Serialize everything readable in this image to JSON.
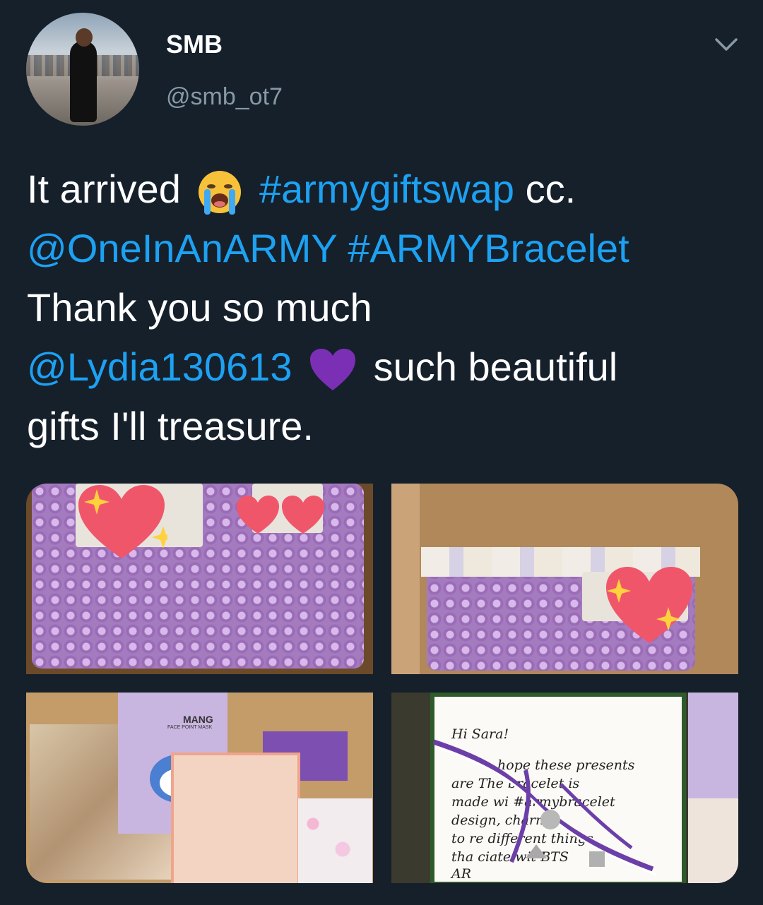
{
  "author": {
    "display_name": "SMB",
    "handle": "@smb_ot7"
  },
  "tweet": {
    "line1": {
      "text_a": "It arrived",
      "hashtag": "#armygiftswap",
      "text_b": "cc."
    },
    "line2": {
      "mention": "@OneInAnARMY",
      "hashtag": "#ARMYBracelet"
    },
    "line3": {
      "text": "Thank you so much"
    },
    "line4": {
      "mention": "@Lydia130613",
      "text": "such beautiful"
    },
    "line5": {
      "text": "gifts I'll treasure."
    }
  },
  "icons": {
    "more": "chevron-down-icon",
    "emoji1": "loudly-crying-face-emoji",
    "emoji2": "purple-heart-emoji"
  },
  "colors": {
    "background": "#15202b",
    "link": "#1da1f2",
    "secondary_text": "#8899a6"
  },
  "media": {
    "tile3": {
      "brand": "MANG",
      "subtitle": "FACE POINT MASK"
    },
    "tile4": {
      "note_lines": [
        "Hi Sara!",
        "hope these presents",
        "are The bracelet is",
        "made wi #armybracelet",
        "design, charms",
        "to re different things",
        "tha ciate wit BTS",
        "AR"
      ]
    }
  }
}
